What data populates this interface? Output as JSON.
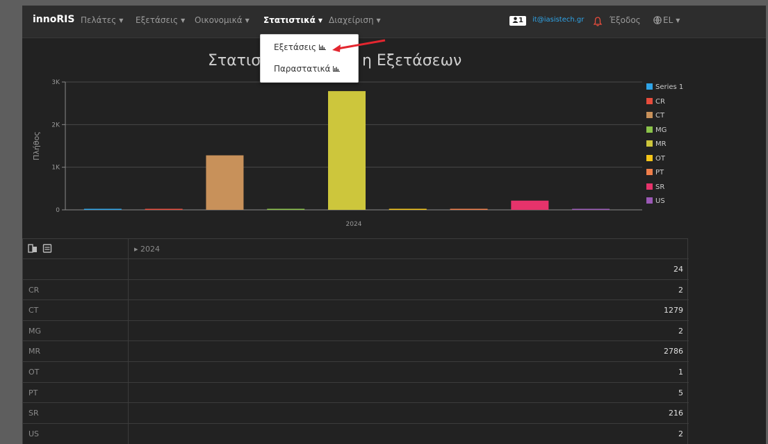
{
  "navbar": {
    "brand": "innoRIS",
    "menus": [
      {
        "label": "Πελάτες"
      },
      {
        "label": "Εξετάσεις"
      },
      {
        "label": "Οικονομικά"
      },
      {
        "label": "Στατιστικά"
      },
      {
        "label": "Διαχείριση"
      }
    ],
    "user_count": "1",
    "user_email": "it@iasistech.gr",
    "logout": "Έξοδος",
    "language": "EL"
  },
  "dropdown": {
    "items": [
      {
        "label": "Εξετάσεις"
      },
      {
        "label": "Παραστατικά"
      }
    ]
  },
  "chart_data": {
    "type": "bar",
    "title_left": "Στατισ",
    "title_right": "η Εξετάσεων",
    "ylabel": "Πλήθος",
    "ylim": [
      0,
      3000
    ],
    "yticks": [
      "0",
      "1K",
      "2K",
      "3K"
    ],
    "categories": [
      "2024"
    ],
    "series": [
      {
        "name": "Series 1",
        "values": [
          24
        ],
        "color": "#2fa4e7"
      },
      {
        "name": "CR",
        "values": [
          2
        ],
        "color": "#e74c3c"
      },
      {
        "name": "CT",
        "values": [
          1279
        ],
        "color": "#c8915a"
      },
      {
        "name": "MG",
        "values": [
          2
        ],
        "color": "#8bc34a"
      },
      {
        "name": "MR",
        "values": [
          2786
        ],
        "color": "#cdc63c"
      },
      {
        "name": "OT",
        "values": [
          1
        ],
        "color": "#f5c518"
      },
      {
        "name": "PT",
        "values": [
          5
        ],
        "color": "#f07f4a"
      },
      {
        "name": "SR",
        "values": [
          216
        ],
        "color": "#e6336b"
      },
      {
        "name": "US",
        "values": [
          2
        ],
        "color": "#9b59b6"
      }
    ]
  },
  "table": {
    "header_year": "▸ 2024",
    "rows": [
      {
        "label": "",
        "value": "24"
      },
      {
        "label": "CR",
        "value": "2"
      },
      {
        "label": "CT",
        "value": "1279"
      },
      {
        "label": "MG",
        "value": "2"
      },
      {
        "label": "MR",
        "value": "2786"
      },
      {
        "label": "OT",
        "value": "1"
      },
      {
        "label": "PT",
        "value": "5"
      },
      {
        "label": "SR",
        "value": "216"
      },
      {
        "label": "US",
        "value": "2"
      }
    ]
  }
}
